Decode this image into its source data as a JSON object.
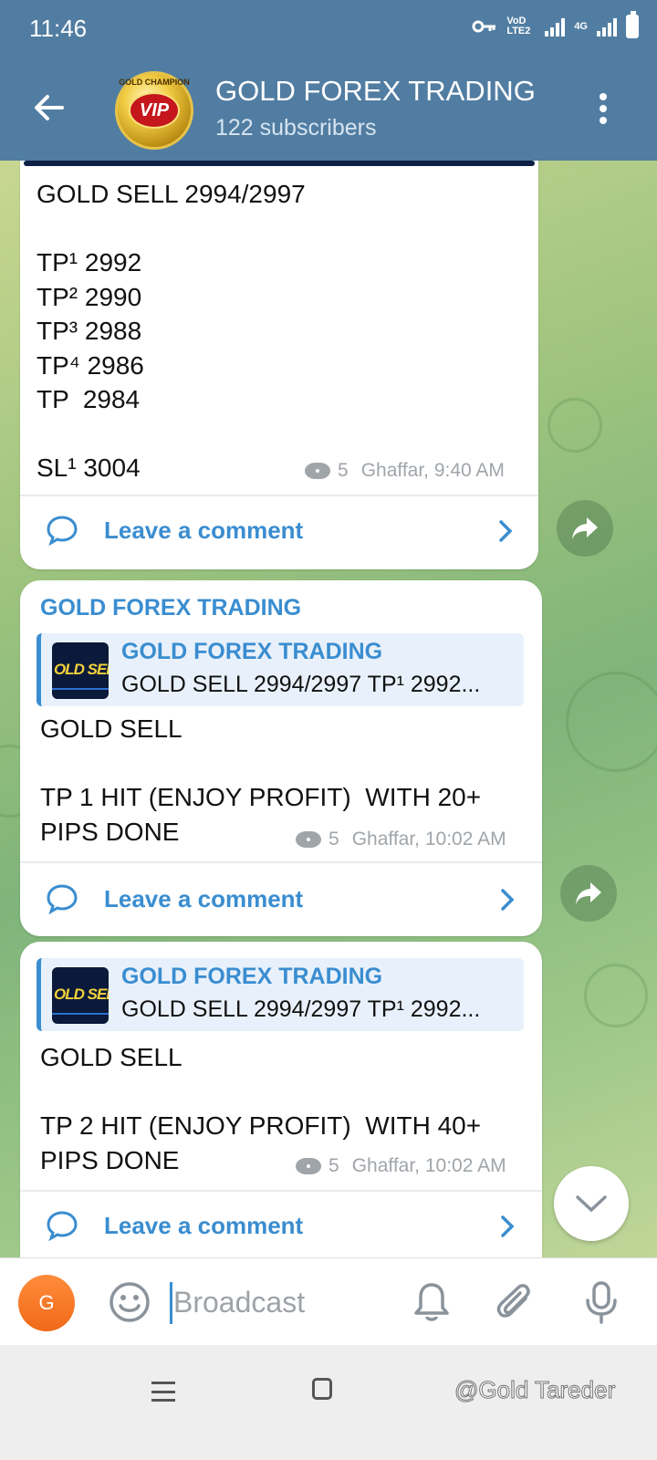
{
  "status_bar": {
    "time": "11:46",
    "network_label": "VoD LTE2",
    "network2_label": "4G"
  },
  "header": {
    "channel_name": "GOLD FOREX TRADING",
    "subscribers": "122 subscribers",
    "avatar_top_text": "GOLD CHAMPION",
    "avatar_badge": "VIP"
  },
  "messages": [
    {
      "text": "GOLD SELL 2994/2997\n\nTP¹ 2992\nTP² 2990\nTP³ 2988\nTP⁴ 2986\nTP  2984\n\nSL¹ 3004",
      "views": "5",
      "author_time": "Ghaffar, 9:40 AM",
      "comment_label": "Leave a comment"
    },
    {
      "sender": "GOLD FOREX TRADING",
      "quote_title": "GOLD FOREX TRADING",
      "quote_text": "GOLD SELL 2994/2997  TP¹ 2992...",
      "quote_thumb_text": "OLD SEL",
      "text": "GOLD SELL\n\nTP 1 HIT (ENJOY PROFIT)  WITH 20+\nPIPS DONE",
      "views": "5",
      "author_time": "Ghaffar, 10:02 AM",
      "comment_label": "Leave a comment"
    },
    {
      "quote_title": "GOLD FOREX TRADING",
      "quote_text": "GOLD SELL 2994/2997  TP¹ 2992...",
      "quote_thumb_text": "OLD SEL",
      "text": "GOLD SELL\n\nTP 2 HIT (ENJOY PROFIT)  WITH 40+\nPIPS DONE",
      "views": "5",
      "author_time": "Ghaffar, 10:02 AM",
      "comment_label": "Leave a comment"
    }
  ],
  "input_bar": {
    "avatar_letter": "G",
    "placeholder": "Broadcast"
  },
  "watermark": "@Gold Tareder",
  "colors": {
    "header_bg": "#517da2",
    "link_blue": "#3a8dd0",
    "avatar_orange": "#f07a2a"
  },
  "icons": [
    "back-arrow-icon",
    "more-vert-icon",
    "eye-icon",
    "comment-icon",
    "chevron-right-icon",
    "share-icon",
    "chevron-down-icon",
    "emoji-icon",
    "bell-icon",
    "paperclip-icon",
    "microphone-icon"
  ]
}
